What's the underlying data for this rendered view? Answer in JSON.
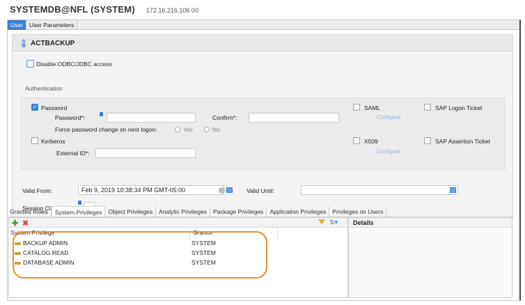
{
  "window": {
    "connection": "SYSTEMDB@NFL (SYSTEM)",
    "host": "172.16.216.106 00"
  },
  "tabs": [
    {
      "label": "User",
      "active": true
    },
    {
      "label": "User Parameters",
      "active": false
    }
  ],
  "user": {
    "name": "ACTBACKUP",
    "disable_odbc_label": "Disable ODBC/JDBC access",
    "disable_odbc_checked": false
  },
  "authentication": {
    "section_label": "Authentication",
    "password_label": "Password",
    "password_checked": true,
    "password_field_label": "Password*:",
    "confirm_label": "Confirm*:",
    "force_change_label": "Force password change on next logon:",
    "force_change_options": [
      "Yes",
      "No"
    ],
    "kerberos_label": "Kerberos",
    "external_id_label": "External ID*:",
    "saml_label": "SAML",
    "saml_configure": "Configure",
    "sap_logon_ticket_label": "SAP Logon Ticket",
    "x509_label": "X509",
    "x509_configure": "Configure",
    "sap_assertion_ticket_label": "SAP Assertion Ticket"
  },
  "validity": {
    "valid_from_label": "Valid From:",
    "valid_from_value": "Feb 9, 2019 10:38:34 PM GMT-05:00",
    "valid_until_label": "Valid Until:",
    "valid_until_value": "",
    "session_client_label": "Session Client:"
  },
  "sub_tabs": [
    {
      "label": "Granted Roles",
      "active": false
    },
    {
      "label": "System Privileges",
      "active": true
    },
    {
      "label": "Object Privileges",
      "active": false
    },
    {
      "label": "Analytic Privileges",
      "active": false
    },
    {
      "label": "Package Privileges",
      "active": false
    },
    {
      "label": "Application Privileges",
      "active": false
    },
    {
      "label": "Privileges on Users",
      "active": false
    }
  ],
  "privileges_table": {
    "columns": [
      "System Privilege",
      "Grantor"
    ],
    "rows": [
      {
        "privilege": "BACKUP ADMIN",
        "grantor": "SYSTEM"
      },
      {
        "privilege": "CATALOG READ",
        "grantor": "SYSTEM"
      },
      {
        "privilege": "DATABASE ADMIN",
        "grantor": "SYSTEM"
      }
    ]
  },
  "details": {
    "title": "Details"
  },
  "colors": {
    "accent": "#3e7fd6",
    "highlight": "#e8902e"
  },
  "icons": {
    "user": "user-icon",
    "add": "add-icon",
    "remove": "remove-icon",
    "filter": "filter-icon",
    "sort": "sort-icon",
    "calendar": "calendar-icon",
    "privilege": "key-icon"
  }
}
